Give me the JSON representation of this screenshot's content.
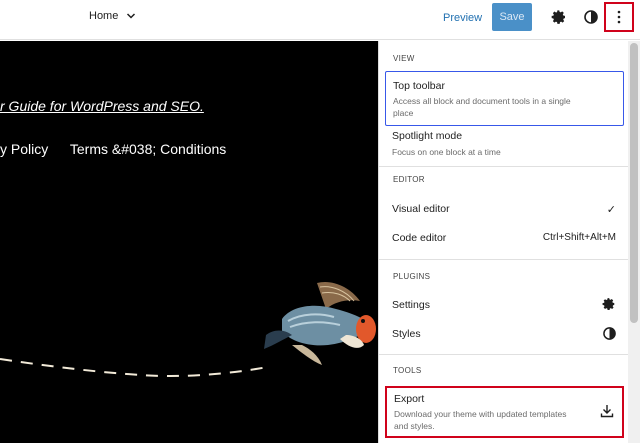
{
  "topbar": {
    "home_label": "Home",
    "preview_label": "Preview",
    "save_label": "Save"
  },
  "canvas": {
    "guide_text": "r Guide for WordPress and SEO.",
    "footer_links": [
      "y Policy",
      "Terms &#038; Conditions"
    ]
  },
  "panel": {
    "view": {
      "title": "VIEW",
      "items": [
        {
          "label": "Top toolbar",
          "desc": "Access all block and document tools in a single place"
        },
        {
          "label": "Spotlight mode",
          "desc": "Focus on one block at a time"
        }
      ]
    },
    "editor": {
      "title": "EDITOR",
      "items": [
        {
          "label": "Visual editor",
          "right": "✓"
        },
        {
          "label": "Code editor",
          "right": "Ctrl+Shift+Alt+M"
        }
      ]
    },
    "plugins": {
      "title": "PLUGINS",
      "items": [
        {
          "label": "Settings",
          "icon": "gear-icon"
        },
        {
          "label": "Styles",
          "icon": "half-circle-icon"
        }
      ]
    },
    "tools": {
      "title": "TOOLS",
      "items": [
        {
          "label": "Export",
          "desc": "Download your theme with updated templates and styles.",
          "icon": "download-icon"
        }
      ]
    }
  },
  "colors": {
    "accent": "#3858e9",
    "highlight": "#d0021b",
    "link": "#2271b1",
    "save_bg": "#4a90c8"
  }
}
